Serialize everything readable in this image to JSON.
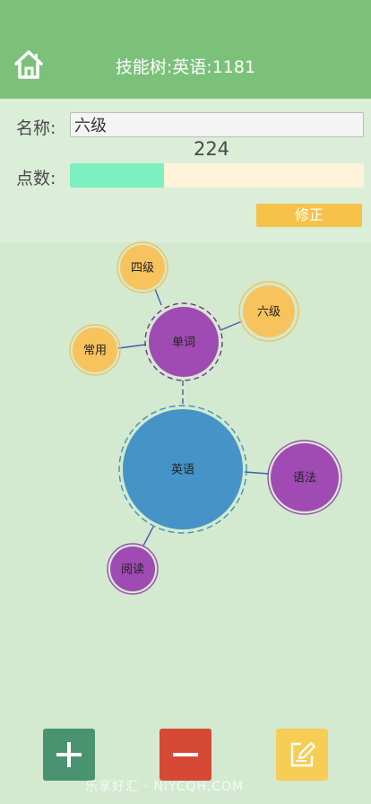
{
  "header": {
    "title": "技能树:英语:1181"
  },
  "form": {
    "name_label": "名称:",
    "name_value": "六级",
    "points_label": "点数:",
    "points_value": "224",
    "progress_fraction": 0.32,
    "fix_button_label": "修正"
  },
  "tree": {
    "nodes": {
      "root": "英语",
      "vocab": "单词",
      "grammar": "语法",
      "reading": "阅读",
      "level4": "四级",
      "level6": "六级",
      "common": "常用"
    }
  },
  "toolbar": {
    "add_icon": "plus-icon",
    "remove_icon": "minus-icon",
    "edit_icon": "edit-icon"
  },
  "watermark": "乐享好汇 · NIYCQH.COM",
  "colors": {
    "header_bg": "#7cc17a",
    "background": "#d3ead0",
    "root_node": "#4593c7",
    "purple_node": "#a04ab3",
    "orange_node": "#f7c35c",
    "add_button": "#4a9370",
    "remove_button": "#d54935",
    "edit_button": "#f7cd55"
  }
}
